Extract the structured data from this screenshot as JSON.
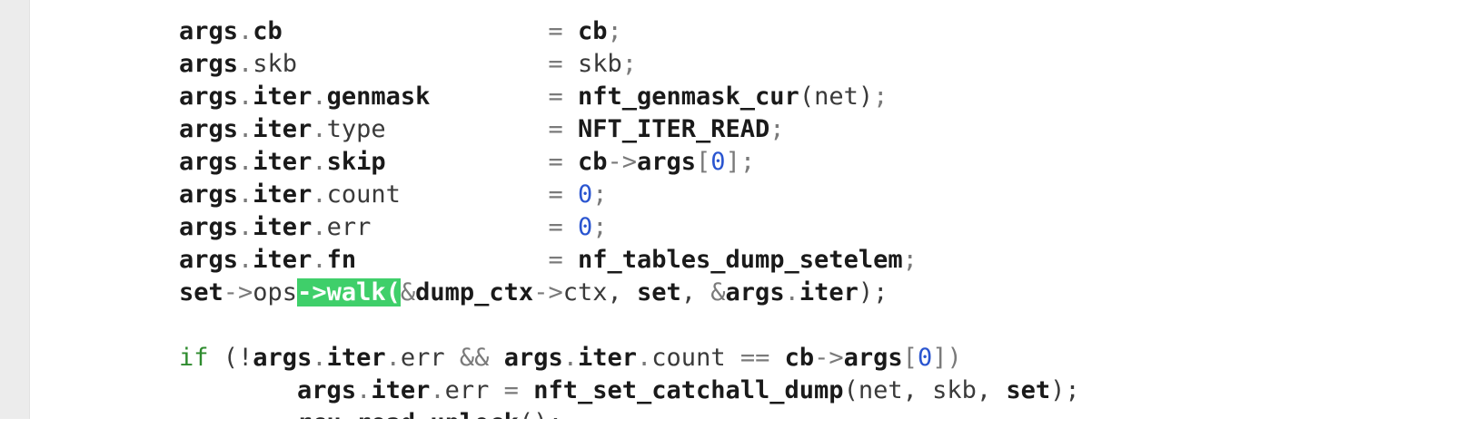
{
  "code_lines": [
    {
      "id": "l1",
      "tokens": [
        {
          "t": "args",
          "c": "kw"
        },
        {
          "t": ".",
          "c": "op"
        },
        {
          "t": "cb",
          "c": "kw"
        },
        {
          "t": "                  ",
          "c": "pl"
        },
        {
          "t": "=",
          "c": "op"
        },
        {
          "t": " ",
          "c": "pl"
        },
        {
          "t": "cb",
          "c": "kw"
        },
        {
          "t": ";",
          "c": "op"
        }
      ]
    },
    {
      "id": "l2",
      "tokens": [
        {
          "t": "args",
          "c": "kw"
        },
        {
          "t": ".",
          "c": "op"
        },
        {
          "t": "skb",
          "c": "pl"
        },
        {
          "t": "                 ",
          "c": "pl"
        },
        {
          "t": "=",
          "c": "op"
        },
        {
          "t": " skb",
          "c": "pl"
        },
        {
          "t": ";",
          "c": "op"
        }
      ]
    },
    {
      "id": "l3",
      "tokens": [
        {
          "t": "args",
          "c": "kw"
        },
        {
          "t": ".",
          "c": "op"
        },
        {
          "t": "iter",
          "c": "kw"
        },
        {
          "t": ".",
          "c": "op"
        },
        {
          "t": "genmask",
          "c": "kw"
        },
        {
          "t": "        ",
          "c": "pl"
        },
        {
          "t": "=",
          "c": "op"
        },
        {
          "t": " ",
          "c": "pl"
        },
        {
          "t": "nft_genmask_cur",
          "c": "kw"
        },
        {
          "t": "(net)",
          "c": "pl"
        },
        {
          "t": ";",
          "c": "op"
        }
      ]
    },
    {
      "id": "l4",
      "tokens": [
        {
          "t": "args",
          "c": "kw"
        },
        {
          "t": ".",
          "c": "op"
        },
        {
          "t": "iter",
          "c": "kw"
        },
        {
          "t": ".",
          "c": "op"
        },
        {
          "t": "type",
          "c": "pl"
        },
        {
          "t": "           ",
          "c": "pl"
        },
        {
          "t": "=",
          "c": "op"
        },
        {
          "t": " ",
          "c": "pl"
        },
        {
          "t": "NFT_ITER_READ",
          "c": "kw"
        },
        {
          "t": ";",
          "c": "op"
        }
      ]
    },
    {
      "id": "l5",
      "tokens": [
        {
          "t": "args",
          "c": "kw"
        },
        {
          "t": ".",
          "c": "op"
        },
        {
          "t": "iter",
          "c": "kw"
        },
        {
          "t": ".",
          "c": "op"
        },
        {
          "t": "skip",
          "c": "kw"
        },
        {
          "t": "           ",
          "c": "pl"
        },
        {
          "t": "=",
          "c": "op"
        },
        {
          "t": " ",
          "c": "pl"
        },
        {
          "t": "cb",
          "c": "kw"
        },
        {
          "t": "->",
          "c": "op"
        },
        {
          "t": "args",
          "c": "kw"
        },
        {
          "t": "[",
          "c": "op"
        },
        {
          "t": "0",
          "c": "num"
        },
        {
          "t": "]",
          "c": "op"
        },
        {
          "t": ";",
          "c": "op"
        }
      ]
    },
    {
      "id": "l6",
      "tokens": [
        {
          "t": "args",
          "c": "kw"
        },
        {
          "t": ".",
          "c": "op"
        },
        {
          "t": "iter",
          "c": "kw"
        },
        {
          "t": ".",
          "c": "op"
        },
        {
          "t": "count",
          "c": "pl"
        },
        {
          "t": "          ",
          "c": "pl"
        },
        {
          "t": "=",
          "c": "op"
        },
        {
          "t": " ",
          "c": "pl"
        },
        {
          "t": "0",
          "c": "num"
        },
        {
          "t": ";",
          "c": "op"
        }
      ]
    },
    {
      "id": "l7",
      "tokens": [
        {
          "t": "args",
          "c": "kw"
        },
        {
          "t": ".",
          "c": "op"
        },
        {
          "t": "iter",
          "c": "kw"
        },
        {
          "t": ".",
          "c": "op"
        },
        {
          "t": "err",
          "c": "pl"
        },
        {
          "t": "            ",
          "c": "pl"
        },
        {
          "t": "=",
          "c": "op"
        },
        {
          "t": " ",
          "c": "pl"
        },
        {
          "t": "0",
          "c": "num"
        },
        {
          "t": ";",
          "c": "op"
        }
      ]
    },
    {
      "id": "l8",
      "tokens": [
        {
          "t": "args",
          "c": "kw"
        },
        {
          "t": ".",
          "c": "op"
        },
        {
          "t": "iter",
          "c": "kw"
        },
        {
          "t": ".",
          "c": "op"
        },
        {
          "t": "fn",
          "c": "kw"
        },
        {
          "t": "             ",
          "c": "pl"
        },
        {
          "t": "=",
          "c": "op"
        },
        {
          "t": " ",
          "c": "pl"
        },
        {
          "t": "nf_tables_dump_setelem",
          "c": "kw"
        },
        {
          "t": ";",
          "c": "op"
        }
      ]
    },
    {
      "id": "l9",
      "tokens": [
        {
          "t": "set",
          "c": "kw"
        },
        {
          "t": "->",
          "c": "op"
        },
        {
          "t": "ops",
          "c": "pl"
        },
        {
          "t": "->walk(",
          "c": "hl"
        },
        {
          "t": "&",
          "c": "op"
        },
        {
          "t": "dump_ctx",
          "c": "kw"
        },
        {
          "t": "->",
          "c": "op"
        },
        {
          "t": "ctx, ",
          "c": "pl"
        },
        {
          "t": "set",
          "c": "kw"
        },
        {
          "t": ", ",
          "c": "pl"
        },
        {
          "t": "&",
          "c": "op"
        },
        {
          "t": "args",
          "c": "kw"
        },
        {
          "t": ".",
          "c": "op"
        },
        {
          "t": "iter",
          "c": "kw"
        },
        {
          "t": ");",
          "c": "pl"
        }
      ]
    },
    {
      "id": "l10",
      "tokens": []
    },
    {
      "id": "l11",
      "tokens": [
        {
          "t": "if",
          "c": "ctl"
        },
        {
          "t": " (!",
          "c": "pl"
        },
        {
          "t": "args",
          "c": "kw"
        },
        {
          "t": ".",
          "c": "op"
        },
        {
          "t": "iter",
          "c": "kw"
        },
        {
          "t": ".",
          "c": "op"
        },
        {
          "t": "err",
          "c": "pl"
        },
        {
          "t": " && ",
          "c": "op"
        },
        {
          "t": "args",
          "c": "kw"
        },
        {
          "t": ".",
          "c": "op"
        },
        {
          "t": "iter",
          "c": "kw"
        },
        {
          "t": ".",
          "c": "op"
        },
        {
          "t": "count",
          "c": "pl"
        },
        {
          "t": " == ",
          "c": "op"
        },
        {
          "t": "cb",
          "c": "kw"
        },
        {
          "t": "->",
          "c": "op"
        },
        {
          "t": "args",
          "c": "kw"
        },
        {
          "t": "[",
          "c": "op"
        },
        {
          "t": "0",
          "c": "num"
        },
        {
          "t": "])",
          "c": "op"
        }
      ]
    },
    {
      "id": "l12",
      "tokens": [
        {
          "t": "        ",
          "c": "pl"
        },
        {
          "t": "args",
          "c": "kw"
        },
        {
          "t": ".",
          "c": "op"
        },
        {
          "t": "iter",
          "c": "kw"
        },
        {
          "t": ".",
          "c": "op"
        },
        {
          "t": "err",
          "c": "pl"
        },
        {
          "t": " = ",
          "c": "op"
        },
        {
          "t": "nft_set_catchall_dump",
          "c": "kw"
        },
        {
          "t": "(net, skb, ",
          "c": "pl"
        },
        {
          "t": "set",
          "c": "kw"
        },
        {
          "t": ");",
          "c": "pl"
        }
      ]
    },
    {
      "id": "l13",
      "tokens": [
        {
          "t": "        ",
          "c": "pl"
        },
        {
          "t": "rcu_read_unlock",
          "c": "kw"
        },
        {
          "t": "();",
          "c": "pl"
        }
      ]
    }
  ]
}
